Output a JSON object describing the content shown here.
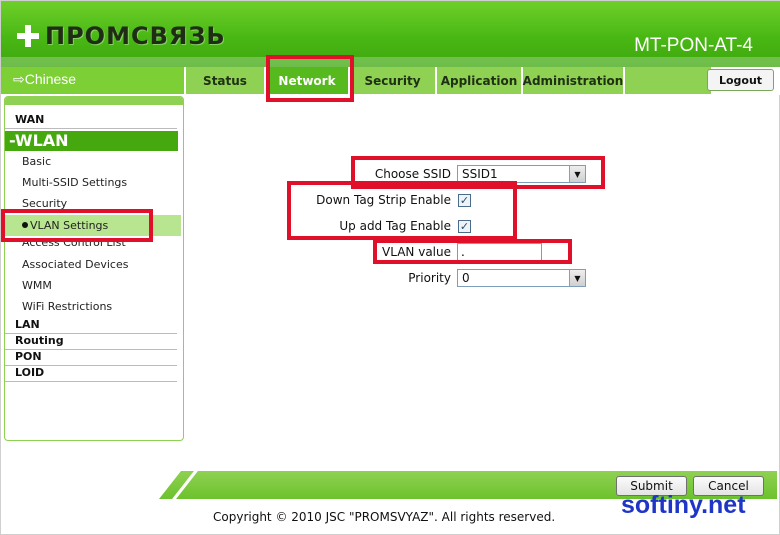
{
  "header": {
    "logo_text": "ПРОМСВЯЗЬ",
    "model": "MT-PON-AT-4"
  },
  "navbar": {
    "language_link": "⇨Chinese",
    "tabs": [
      {
        "label": "Status"
      },
      {
        "label": "Network"
      },
      {
        "label": "Security"
      },
      {
        "label": "Application"
      },
      {
        "label": "Administration"
      }
    ],
    "active_tab": "Network",
    "logout_label": "Logout"
  },
  "sidebar": {
    "wan": "WAN",
    "wlan": "-WLAN",
    "wlan_items": [
      {
        "label": "Basic"
      },
      {
        "label": "Multi-SSID Settings"
      },
      {
        "label": "Security"
      },
      {
        "label": "VLAN Settings"
      },
      {
        "label": "Access Control List"
      },
      {
        "label": "Associated Devices"
      },
      {
        "label": "WMM"
      },
      {
        "label": "WiFi Restrictions"
      }
    ],
    "active_item": "VLAN Settings",
    "lan": "LAN",
    "routing": "Routing",
    "pon": "PON",
    "loid": "LOID"
  },
  "form": {
    "choose_ssid_label": "Choose SSID",
    "choose_ssid_value": "SSID1",
    "down_tag_label": "Down Tag Strip Enable",
    "down_tag_checked": true,
    "up_tag_label": "Up add Tag Enable",
    "up_tag_checked": true,
    "vlan_label": "VLAN value",
    "vlan_value": ".",
    "priority_label": "Priority",
    "priority_value": "0"
  },
  "footer": {
    "submit_label": "Submit",
    "cancel_label": "Cancel",
    "copyright": "Copyright © 2010 JSC \"PROMSVYAZ\". All rights reserved."
  },
  "watermark": "softiny.net",
  "colors": {
    "brand_green": "#49b814",
    "highlight_red": "#e0102a",
    "watermark_blue": "#1f35c8"
  }
}
